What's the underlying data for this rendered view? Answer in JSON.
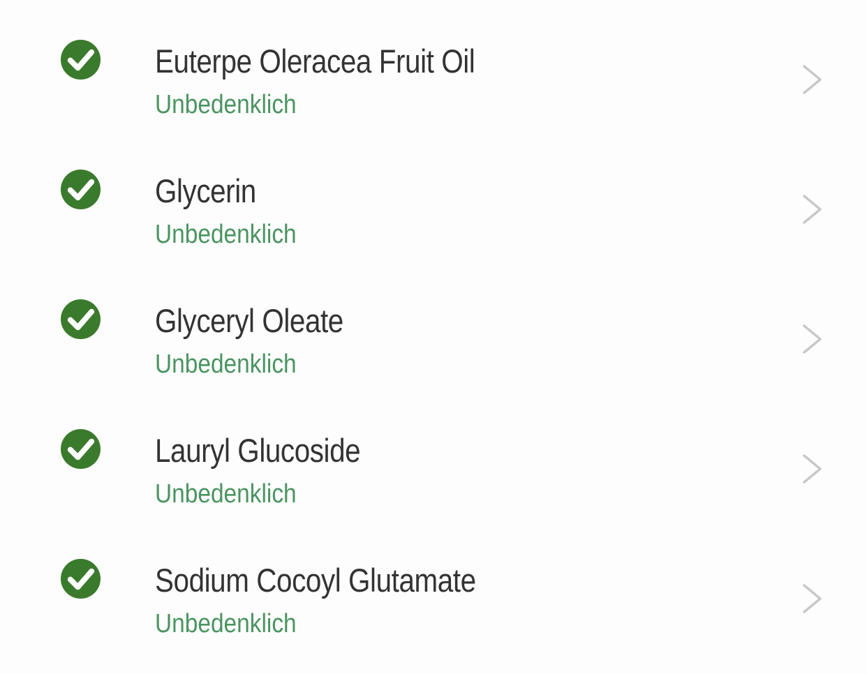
{
  "colors": {
    "check_fill": "#3a7a2c",
    "status_text": "#4a9460",
    "name_text": "#333333",
    "chevron": "#c8c8c8"
  },
  "ingredients": [
    {
      "name": "Euterpe Oleracea Fruit Oil",
      "status": "Unbedenklich",
      "icon": "check-circle-icon"
    },
    {
      "name": "Glycerin",
      "status": "Unbedenklich",
      "icon": "check-circle-icon"
    },
    {
      "name": "Glyceryl Oleate",
      "status": "Unbedenklich",
      "icon": "check-circle-icon"
    },
    {
      "name": "Lauryl Glucoside",
      "status": "Unbedenklich",
      "icon": "check-circle-icon"
    },
    {
      "name": "Sodium Cocoyl Glutamate",
      "status": "Unbedenklich",
      "icon": "check-circle-icon"
    }
  ]
}
